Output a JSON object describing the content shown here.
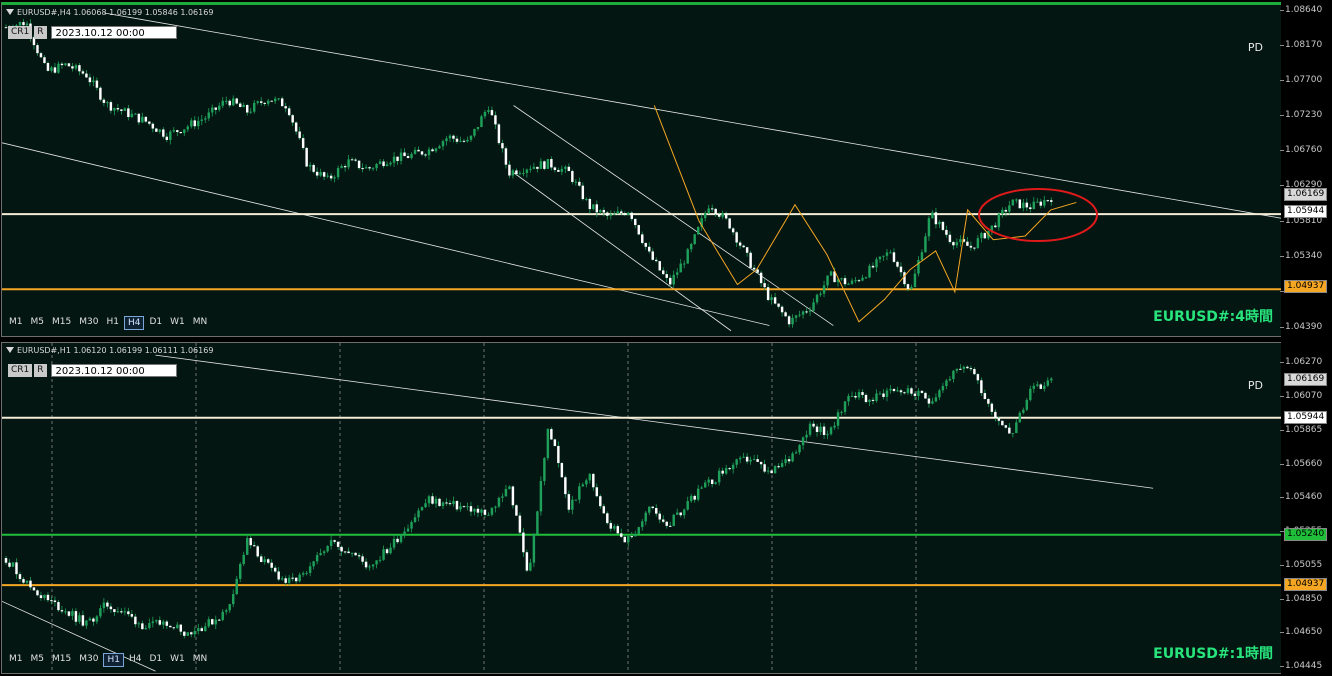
{
  "panels": [
    {
      "id": "h4",
      "header_text": "EURUSD#,H4  1.06068 1.06199 1.05846 1.06169",
      "buttons": [
        "CR1",
        "R"
      ],
      "date": "2023.10.12 00:00",
      "pd_label": "PD",
      "chart_label": "EURUSD#:4時間",
      "timeframes": [
        "M1",
        "M5",
        "M15",
        "M30",
        "H1",
        "H4",
        "D1",
        "W1",
        "MN"
      ],
      "active_timeframe": "H4",
      "price_ticks": [
        "1.08640",
        "1.08170",
        "1.07700",
        "1.07230",
        "1.06760",
        "1.06290",
        "1.05810",
        "1.05340",
        "1.04870",
        "1.04390"
      ],
      "price_boxes": [
        {
          "text": "1.06169",
          "bg": "#d8d8d8",
          "fg": "#000000"
        },
        {
          "text": "1.05944",
          "bg": "#ffffff",
          "fg": "#000000"
        },
        {
          "text": "1.04937",
          "bg": "#f5a623",
          "fg": "#000000"
        }
      ]
    },
    {
      "id": "h1",
      "header_text": "EURUSD#,H1  1.06120 1.06199 1.06111 1.06169",
      "buttons": [
        "CR1",
        "R"
      ],
      "date": "2023.10.12 00:00",
      "pd_label": "PD",
      "chart_label": "EURUSD#:1時間",
      "timeframes": [
        "M1",
        "M5",
        "M15",
        "M30",
        "H1",
        "H4",
        "D1",
        "W1",
        "MN"
      ],
      "active_timeframe": "H1",
      "price_ticks": [
        "1.06270",
        "1.06070",
        "1.05865",
        "1.05660",
        "1.05460",
        "1.05255",
        "1.05055",
        "1.04850",
        "1.04650",
        "1.04445"
      ],
      "price_boxes": [
        {
          "text": "1.06169",
          "bg": "#d8d8d8",
          "fg": "#000000"
        },
        {
          "text": "1.05944",
          "bg": "#ffffff",
          "fg": "#000000"
        },
        {
          "text": "1.05240",
          "bg": "#1fbf3a",
          "fg": "#000000"
        },
        {
          "text": "1.04937",
          "bg": "#f5a623",
          "fg": "#000000"
        }
      ]
    }
  ],
  "chart_data": [
    {
      "type": "candlestick",
      "symbol": "EURUSD#",
      "timeframe": "H4",
      "ylim": [
        1.0439,
        1.0864
      ],
      "horizontal_levels": [
        {
          "price": 1.05944,
          "color": "#f3ecd6"
        },
        {
          "price": 1.04937,
          "color": "#f5a623"
        }
      ],
      "close_path": [
        1.0845,
        1.0852,
        1.0785,
        1.0795,
        1.0781,
        1.0742,
        1.073,
        1.0718,
        1.07,
        1.0712,
        1.0725,
        1.0748,
        1.0732,
        1.075,
        1.074,
        1.066,
        1.064,
        1.0665,
        1.0655,
        1.0668,
        1.0672,
        1.068,
        1.0698,
        1.069,
        1.074,
        1.065,
        1.0658,
        1.0662,
        1.065,
        1.0605,
        1.059,
        1.06,
        1.054,
        1.05,
        1.0545,
        1.061,
        1.058,
        1.053,
        1.048,
        1.045,
        1.047,
        1.0512,
        1.05,
        1.052,
        1.0545,
        1.049,
        1.0595,
        1.056,
        1.055,
        1.0575,
        1.061,
        1.0604,
        1.0617
      ],
      "trendlines": [
        {
          "color": "#e6e6e6",
          "p": [
            [
              0.08,
              1.0864
            ],
            [
              1.08,
              1.0565
            ]
          ]
        },
        {
          "color": "#e6e6e6",
          "p": [
            [
              0.0,
              1.069
            ],
            [
              0.6,
              1.0445
            ]
          ]
        },
        {
          "color": "#e6e6e6",
          "p": [
            [
              0.4,
              1.074
            ],
            [
              0.65,
              1.0445
            ]
          ]
        },
        {
          "color": "#e6e6e6",
          "p": [
            [
              0.4,
              1.065
            ],
            [
              0.57,
              1.0438
            ]
          ]
        }
      ],
      "zigzag": [
        [
          0.51,
          1.074
        ],
        [
          0.545,
          1.0585
        ],
        [
          0.575,
          1.05
        ],
        [
          0.59,
          1.052
        ],
        [
          0.62,
          1.0607
        ],
        [
          0.645,
          1.054
        ],
        [
          0.67,
          1.045
        ],
        [
          0.69,
          1.048
        ],
        [
          0.71,
          1.052
        ],
        [
          0.73,
          1.0545
        ],
        [
          0.745,
          1.049
        ],
        [
          0.755,
          1.06
        ],
        [
          0.775,
          1.056
        ],
        [
          0.8,
          1.0565
        ],
        [
          0.82,
          1.06
        ],
        [
          0.84,
          1.061
        ]
      ]
    },
    {
      "type": "candlestick",
      "symbol": "EURUSD#",
      "timeframe": "H1",
      "ylim": [
        1.04445,
        1.06345
      ],
      "horizontal_levels": [
        {
          "price": 1.05944,
          "color": "#f3ecd6"
        },
        {
          "price": 1.0524,
          "color": "#1fbf3a"
        },
        {
          "price": 1.04937,
          "color": "#f5a623"
        }
      ],
      "close_path": [
        1.051,
        1.0495,
        1.0485,
        1.0478,
        1.047,
        1.0482,
        1.0476,
        1.0468,
        1.0472,
        1.0465,
        1.047,
        1.0478,
        1.052,
        1.0505,
        1.0495,
        1.05,
        1.052,
        1.0515,
        1.0505,
        1.0515,
        1.053,
        1.0545,
        1.0542,
        1.054,
        1.0535,
        1.0555,
        1.05,
        1.059,
        1.054,
        1.056,
        1.053,
        1.052,
        1.054,
        1.053,
        1.0545,
        1.0555,
        1.0565,
        1.057,
        1.056,
        1.057,
        1.059,
        1.0585,
        1.061,
        1.0605,
        1.0612,
        1.061,
        1.0605,
        1.062,
        1.0625,
        1.06,
        1.0585,
        1.061,
        1.0617
      ],
      "trendlines": [
        {
          "color": "#e6e6e6",
          "p": [
            [
              0.12,
              1.0632
            ],
            [
              0.9,
              1.0552
            ]
          ]
        },
        {
          "color": "#e6e6e6",
          "p": [
            [
              0.0,
              1.0484
            ],
            [
              0.12,
              1.0442
            ]
          ]
        }
      ],
      "vertical_separators_count": 7
    }
  ]
}
